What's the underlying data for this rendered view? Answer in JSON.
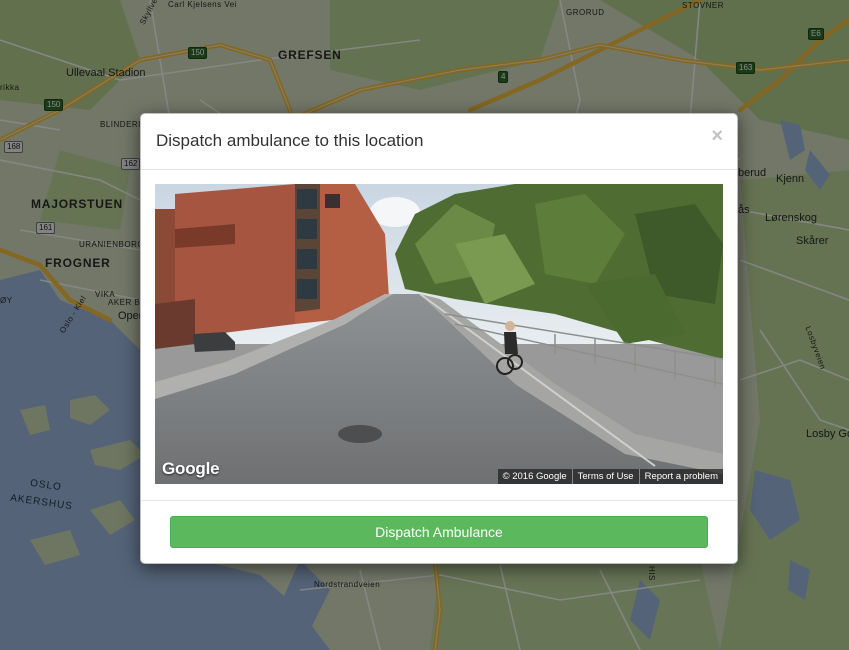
{
  "map": {
    "labels": {
      "ullevaal": "Ullevaal Stadion",
      "grefsen": "GREFSEN",
      "grorud": "GRORUD",
      "stovner": "STOVNER",
      "majorstuen": "MAJORSTUEN",
      "frogner": "FROGNER",
      "blinderi": "BLINDERI",
      "uranienborg": "URANIENBORG",
      "aker_brygge": "AKER BRYG",
      "vika": "VIKA",
      "oper": "Oper",
      "oslo_kiel": "Oslo - Kiel",
      "oslo_akershus": "OSLO\nAKERSHUS",
      "kjenn": "Kjenn",
      "lorenskog": "Lørenskog",
      "skarer": "Skårer",
      "losby": "Losby Go",
      "nordstrandveien": "Nordstrandveien",
      "berud": "berud",
      "as": "ås",
      "carl_kjelsens": "Carl Kjelsens Vei",
      "rikka": "rikka",
      "skyllveien": "Skyllveien",
      "losbyveien": "Losbyveien",
      "bygdoy": "ØY",
      "his": "HIS"
    },
    "shields": {
      "r150a": "150",
      "r150b": "150",
      "r4": "4",
      "r163": "163",
      "e6": "E6",
      "r168": "168",
      "r162": "162",
      "r161": "161"
    }
  },
  "modal": {
    "title": "Dispatch ambulance to this location",
    "close_glyph": "×",
    "street_view": {
      "logo": "Google",
      "copyright": "© 2016 Google",
      "terms": "Terms of Use",
      "report": "Report a problem"
    },
    "dispatch_button": "Dispatch Ambulance"
  },
  "colors": {
    "button": "#5cb85c",
    "map_land": "#c9d9aa",
    "map_water": "#9bb8de",
    "highway": "#f7c44a"
  }
}
